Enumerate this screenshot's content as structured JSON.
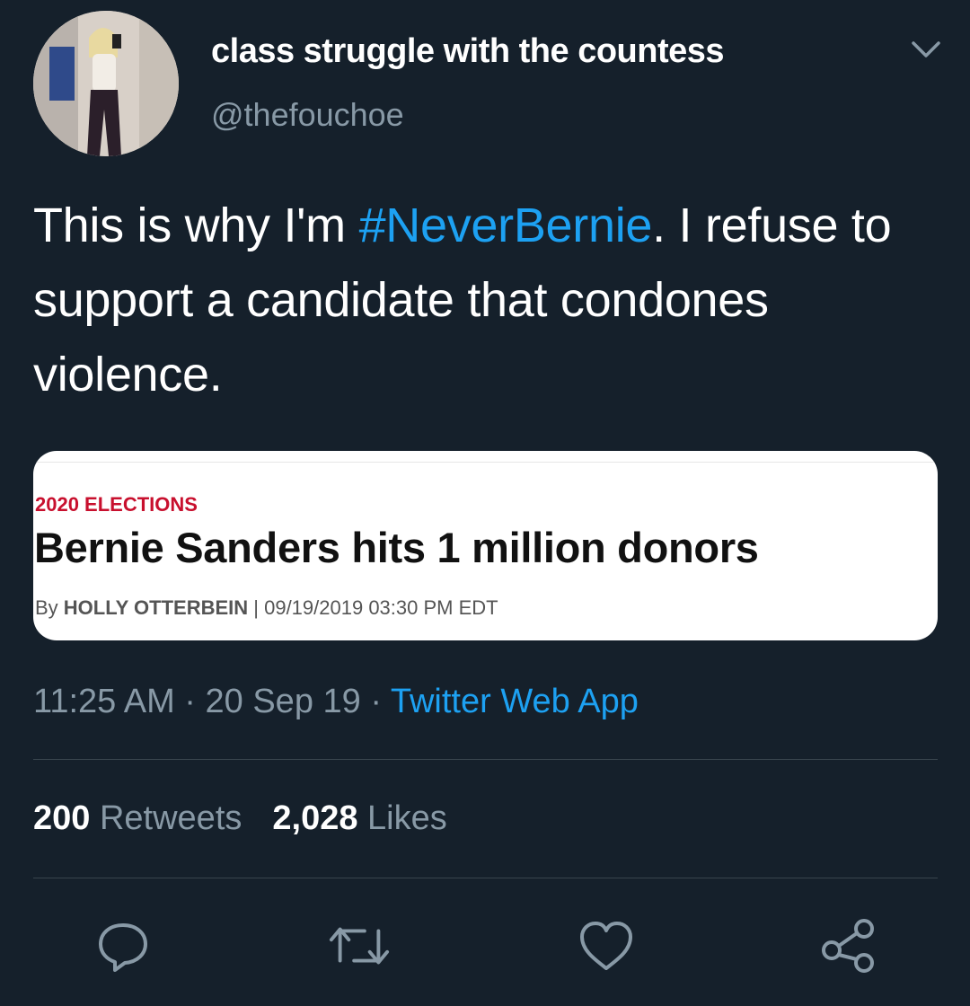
{
  "author": {
    "display_name": "class struggle with the countess",
    "handle": "@thefouchoe"
  },
  "tweet": {
    "text_before": "This is why I'm ",
    "hashtag": "#NeverBernie",
    "text_after": ". I refuse to support a candidate that condones violence."
  },
  "card": {
    "category": "2020 ELECTIONS",
    "headline": "Bernie Sanders hits 1 million donors",
    "byline_prefix": "By ",
    "byline_author": "HOLLY OTTERBEIN",
    "byline_date": " | 09/19/2019 03:30 PM EDT"
  },
  "meta": {
    "time": "11:25 AM",
    "separator": " · ",
    "date": "20 Sep 19",
    "source": "Twitter Web App"
  },
  "stats": {
    "retweets_count": "200",
    "retweets_label": "Retweets",
    "likes_count": "2,028",
    "likes_label": "Likes"
  },
  "icons": {
    "more": "chevron-down-icon",
    "reply": "reply-icon",
    "retweet": "retweet-icon",
    "like": "heart-icon",
    "share": "share-icon"
  },
  "colors": {
    "background": "#15202b",
    "accent": "#1da1f2",
    "secondary_text": "#8899a6",
    "divider": "#38444d",
    "card_category": "#c8102e"
  }
}
